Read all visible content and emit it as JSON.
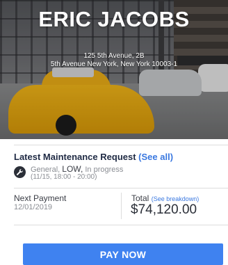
{
  "hero": {
    "name": "ERIC JACOBS",
    "address_line1": "125 5th Avenue, 2B",
    "address_line2": "5th Avenue New York, New York 10003-1"
  },
  "maintenance": {
    "title": "Latest Maintenance Request",
    "see_all": "(See all)",
    "category": "General,",
    "priority": "LOW,",
    "status": "In progress",
    "time_window": "(11/15, 18:00 - 20:00)",
    "icon": "wrench-badge-icon"
  },
  "payment": {
    "next_label": "Next Payment",
    "next_date": "12/01/2019",
    "total_label": "Total",
    "breakdown_link": "(See breakdown)",
    "total_amount": "$74,120.00"
  },
  "actions": {
    "pay_now": "PAY NOW"
  },
  "colors": {
    "accent": "#3f82f0",
    "link": "#3a78e0",
    "taxi": "#f2b619"
  }
}
